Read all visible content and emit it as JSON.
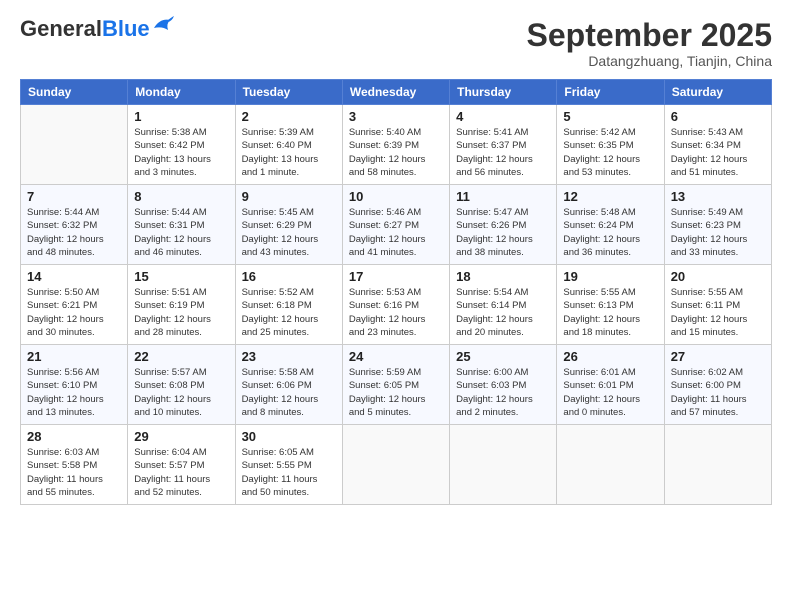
{
  "header": {
    "logo_general": "General",
    "logo_blue": "Blue",
    "month_title": "September 2025",
    "subtitle": "Datangzhuang, Tianjin, China"
  },
  "weekdays": [
    "Sunday",
    "Monday",
    "Tuesday",
    "Wednesday",
    "Thursday",
    "Friday",
    "Saturday"
  ],
  "weeks": [
    [
      {
        "day": "",
        "empty": true
      },
      {
        "day": "1",
        "sunrise": "Sunrise: 5:38 AM",
        "sunset": "Sunset: 6:42 PM",
        "daylight": "Daylight: 13 hours and 3 minutes."
      },
      {
        "day": "2",
        "sunrise": "Sunrise: 5:39 AM",
        "sunset": "Sunset: 6:40 PM",
        "daylight": "Daylight: 13 hours and 1 minute."
      },
      {
        "day": "3",
        "sunrise": "Sunrise: 5:40 AM",
        "sunset": "Sunset: 6:39 PM",
        "daylight": "Daylight: 12 hours and 58 minutes."
      },
      {
        "day": "4",
        "sunrise": "Sunrise: 5:41 AM",
        "sunset": "Sunset: 6:37 PM",
        "daylight": "Daylight: 12 hours and 56 minutes."
      },
      {
        "day": "5",
        "sunrise": "Sunrise: 5:42 AM",
        "sunset": "Sunset: 6:35 PM",
        "daylight": "Daylight: 12 hours and 53 minutes."
      },
      {
        "day": "6",
        "sunrise": "Sunrise: 5:43 AM",
        "sunset": "Sunset: 6:34 PM",
        "daylight": "Daylight: 12 hours and 51 minutes."
      }
    ],
    [
      {
        "day": "7",
        "sunrise": "Sunrise: 5:44 AM",
        "sunset": "Sunset: 6:32 PM",
        "daylight": "Daylight: 12 hours and 48 minutes."
      },
      {
        "day": "8",
        "sunrise": "Sunrise: 5:44 AM",
        "sunset": "Sunset: 6:31 PM",
        "daylight": "Daylight: 12 hours and 46 minutes."
      },
      {
        "day": "9",
        "sunrise": "Sunrise: 5:45 AM",
        "sunset": "Sunset: 6:29 PM",
        "daylight": "Daylight: 12 hours and 43 minutes."
      },
      {
        "day": "10",
        "sunrise": "Sunrise: 5:46 AM",
        "sunset": "Sunset: 6:27 PM",
        "daylight": "Daylight: 12 hours and 41 minutes."
      },
      {
        "day": "11",
        "sunrise": "Sunrise: 5:47 AM",
        "sunset": "Sunset: 6:26 PM",
        "daylight": "Daylight: 12 hours and 38 minutes."
      },
      {
        "day": "12",
        "sunrise": "Sunrise: 5:48 AM",
        "sunset": "Sunset: 6:24 PM",
        "daylight": "Daylight: 12 hours and 36 minutes."
      },
      {
        "day": "13",
        "sunrise": "Sunrise: 5:49 AM",
        "sunset": "Sunset: 6:23 PM",
        "daylight": "Daylight: 12 hours and 33 minutes."
      }
    ],
    [
      {
        "day": "14",
        "sunrise": "Sunrise: 5:50 AM",
        "sunset": "Sunset: 6:21 PM",
        "daylight": "Daylight: 12 hours and 30 minutes."
      },
      {
        "day": "15",
        "sunrise": "Sunrise: 5:51 AM",
        "sunset": "Sunset: 6:19 PM",
        "daylight": "Daylight: 12 hours and 28 minutes."
      },
      {
        "day": "16",
        "sunrise": "Sunrise: 5:52 AM",
        "sunset": "Sunset: 6:18 PM",
        "daylight": "Daylight: 12 hours and 25 minutes."
      },
      {
        "day": "17",
        "sunrise": "Sunrise: 5:53 AM",
        "sunset": "Sunset: 6:16 PM",
        "daylight": "Daylight: 12 hours and 23 minutes."
      },
      {
        "day": "18",
        "sunrise": "Sunrise: 5:54 AM",
        "sunset": "Sunset: 6:14 PM",
        "daylight": "Daylight: 12 hours and 20 minutes."
      },
      {
        "day": "19",
        "sunrise": "Sunrise: 5:55 AM",
        "sunset": "Sunset: 6:13 PM",
        "daylight": "Daylight: 12 hours and 18 minutes."
      },
      {
        "day": "20",
        "sunrise": "Sunrise: 5:55 AM",
        "sunset": "Sunset: 6:11 PM",
        "daylight": "Daylight: 12 hours and 15 minutes."
      }
    ],
    [
      {
        "day": "21",
        "sunrise": "Sunrise: 5:56 AM",
        "sunset": "Sunset: 6:10 PM",
        "daylight": "Daylight: 12 hours and 13 minutes."
      },
      {
        "day": "22",
        "sunrise": "Sunrise: 5:57 AM",
        "sunset": "Sunset: 6:08 PM",
        "daylight": "Daylight: 12 hours and 10 minutes."
      },
      {
        "day": "23",
        "sunrise": "Sunrise: 5:58 AM",
        "sunset": "Sunset: 6:06 PM",
        "daylight": "Daylight: 12 hours and 8 minutes."
      },
      {
        "day": "24",
        "sunrise": "Sunrise: 5:59 AM",
        "sunset": "Sunset: 6:05 PM",
        "daylight": "Daylight: 12 hours and 5 minutes."
      },
      {
        "day": "25",
        "sunrise": "Sunrise: 6:00 AM",
        "sunset": "Sunset: 6:03 PM",
        "daylight": "Daylight: 12 hours and 2 minutes."
      },
      {
        "day": "26",
        "sunrise": "Sunrise: 6:01 AM",
        "sunset": "Sunset: 6:01 PM",
        "daylight": "Daylight: 12 hours and 0 minutes."
      },
      {
        "day": "27",
        "sunrise": "Sunrise: 6:02 AM",
        "sunset": "Sunset: 6:00 PM",
        "daylight": "Daylight: 11 hours and 57 minutes."
      }
    ],
    [
      {
        "day": "28",
        "sunrise": "Sunrise: 6:03 AM",
        "sunset": "Sunset: 5:58 PM",
        "daylight": "Daylight: 11 hours and 55 minutes."
      },
      {
        "day": "29",
        "sunrise": "Sunrise: 6:04 AM",
        "sunset": "Sunset: 5:57 PM",
        "daylight": "Daylight: 11 hours and 52 minutes."
      },
      {
        "day": "30",
        "sunrise": "Sunrise: 6:05 AM",
        "sunset": "Sunset: 5:55 PM",
        "daylight": "Daylight: 11 hours and 50 minutes."
      },
      {
        "day": "",
        "empty": true
      },
      {
        "day": "",
        "empty": true
      },
      {
        "day": "",
        "empty": true
      },
      {
        "day": "",
        "empty": true
      }
    ]
  ]
}
